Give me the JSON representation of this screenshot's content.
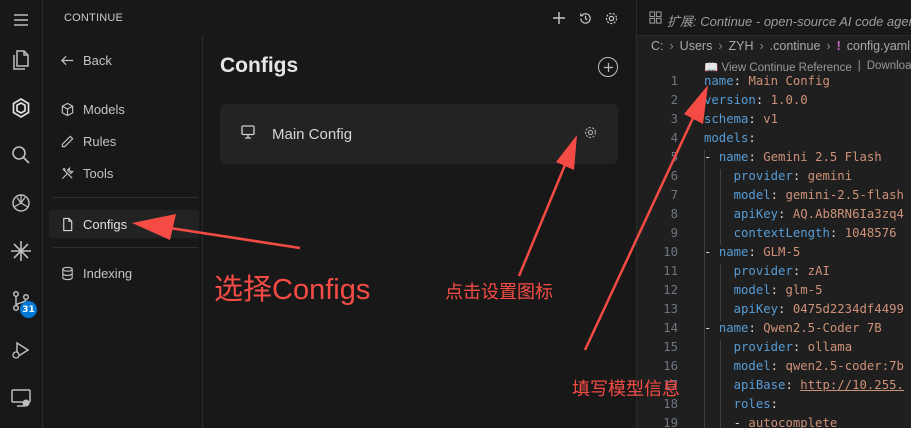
{
  "sidebar": {
    "title": "CONTINUE",
    "badge": "31"
  },
  "nav": {
    "back": "Back",
    "items": [
      "Models",
      "Rules",
      "Tools",
      "Configs",
      "Indexing"
    ]
  },
  "configs": {
    "title": "Configs",
    "items": [
      "Main Config"
    ]
  },
  "editor": {
    "tab": "扩展: Continue - open-source AI code agent",
    "breadcrumbs": [
      "C:",
      "Users",
      "ZYH",
      ".continue",
      "config.yaml"
    ],
    "codelens": [
      "📖 View Continue Reference",
      "|",
      "Download"
    ],
    "lines": [
      {
        "n": "1",
        "key": "name",
        "val": "Main Config"
      },
      {
        "n": "2",
        "key": "version",
        "val": "1.0.0"
      },
      {
        "n": "3",
        "key": "schema",
        "val": "v1"
      },
      {
        "n": "4",
        "key": "models",
        "val": ""
      },
      {
        "n": "5",
        "key": "name",
        "val": "Gemini 2.5 Flash"
      },
      {
        "n": "6",
        "key": "provider",
        "val": "gemini"
      },
      {
        "n": "7",
        "key": "model",
        "val": "gemini-2.5-flash"
      },
      {
        "n": "8",
        "key": "apiKey",
        "val": "AQ.Ab8RN6Ia3zq4"
      },
      {
        "n": "9",
        "key": "contextLength",
        "val": "1048576"
      },
      {
        "n": "10",
        "key": "name",
        "val": "GLM-5"
      },
      {
        "n": "11",
        "key": "provider",
        "val": "zAI"
      },
      {
        "n": "12",
        "key": "model",
        "val": "glm-5"
      },
      {
        "n": "13",
        "key": "apiKey",
        "val": "0475d2234df4499"
      },
      {
        "n": "14",
        "key": "name",
        "val": "Qwen2.5-Coder 7B"
      },
      {
        "n": "15",
        "key": "provider",
        "val": "ollama"
      },
      {
        "n": "16",
        "key": "model",
        "val": "qwen2.5-coder:7b"
      },
      {
        "n": "17",
        "key": "apiBase",
        "val": "http://10.255."
      },
      {
        "n": "18",
        "key": "roles",
        "val": ""
      },
      {
        "n": "19",
        "key": "",
        "val": "autocomplete"
      }
    ]
  },
  "annotations": {
    "select_configs": "选择Configs",
    "click_settings_icon": "点击设置图标",
    "fill_model_info": "填写模型信息"
  },
  "colors": {
    "annotation": "#f44c45",
    "yaml_key": "#569cd6",
    "yaml_value": "#ce9178",
    "badge": "#0078d4"
  }
}
